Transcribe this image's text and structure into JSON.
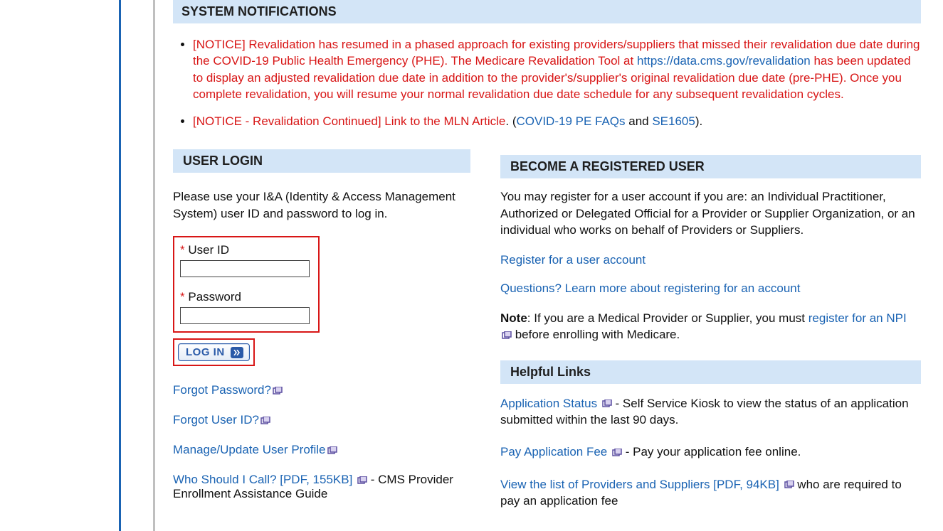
{
  "sections": {
    "notifications_title": "SYSTEM NOTIFICATIONS",
    "user_login_title": "USER LOGIN",
    "become_title": "BECOME A REGISTERED USER",
    "helpful_title": "Helpful Links"
  },
  "notices": {
    "n1_prefix": "[NOTICE] Revalidation has resumed in a phased approach for existing providers/suppliers that missed their revalidation due date during the COVID-19 Public Health Emergency (PHE). The Medicare Revalidation Tool at ",
    "n1_black_link_a": "https://data",
    "n1_blue_link_b": ".cms.gov/revalidation",
    "n1_suffix": " has been updated to display an adjusted revalidation due date in addition to the provider's/supplier's original revalidation due date (pre-PHE). Once you complete revalidation, you will resume your normal revalidation due date schedule for any subsequent revalidation cycles.",
    "n2_prefix": "[NOTICE - Revalidation Continued] Link to the MLN Article",
    "n2_mid": ". (",
    "n2_link1": "COVID-19 PE FAQs",
    "n2_and": " and ",
    "n2_link2": "SE1605",
    "n2_end": ")."
  },
  "login": {
    "intro": "Please use your I&A (Identity & Access Management System) user ID and password to log in.",
    "userid_label": "User ID",
    "password_label": "Password",
    "button_label": "LOG IN"
  },
  "left_links": {
    "forgot_password": "Forgot Password?",
    "forgot_userid": "Forgot User ID?",
    "manage_profile": "Manage/Update User Profile",
    "who_call": "Who Should I Call? [PDF, 155KB]",
    "who_call_after": " - CMS Provider Enrollment Assistance Guide"
  },
  "right": {
    "intro": "You may register for a user account if you are: an Individual Practitioner, Authorized or Delegated Official for a Provider or Supplier Organization, or an individual who works on behalf of Providers or Suppliers.",
    "register_link": "Register for a user account",
    "questions_link": "Questions? Learn more about registering for an account",
    "note_bold": "Note",
    "note_text": ": If you are a Medical Provider or Supplier, you must ",
    "register_npi": "register for an NPI",
    "note_after": " before enrolling with Medicare."
  },
  "helpful": {
    "app_status": "Application Status",
    "app_status_after": " - Self Service Kiosk to view the status of an application submitted within the last 90 days.",
    "pay_fee": "Pay Application Fee",
    "pay_fee_after": " - Pay your application fee online.",
    "view_list": "View the list of Providers and Suppliers [PDF, 94KB]",
    "view_list_after": " who are required to pay an application fee"
  }
}
